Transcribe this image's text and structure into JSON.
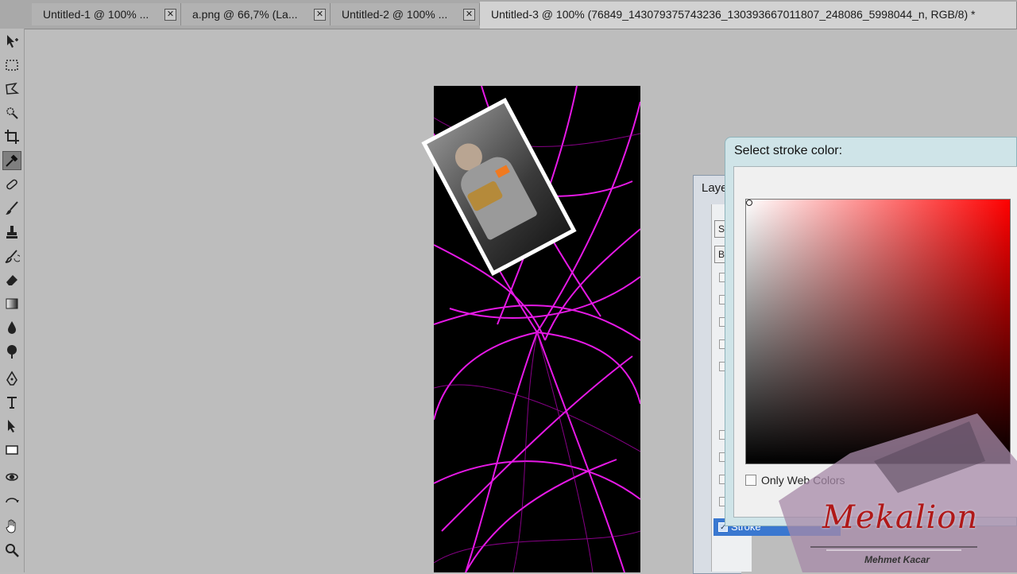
{
  "tabs": [
    {
      "label": "Untitled-1 @ 100% ...",
      "active": false
    },
    {
      "label": "a.png @ 66,7% (La...",
      "active": false
    },
    {
      "label": "Untitled-2 @ 100% ...",
      "active": false
    },
    {
      "label": "Untitled-3 @ 100% (76849_143079375743236_130393667011807_248086_5998044_n, RGB/8) *",
      "active": true
    }
  ],
  "tools": [
    "move-icon",
    "marquee-icon",
    "lasso-icon",
    "quick-select-icon",
    "crop-icon",
    "eyedropper-icon",
    "healing-brush-icon",
    "brush-icon",
    "clone-stamp-icon",
    "history-brush-icon",
    "eraser-icon",
    "gradient-icon",
    "blur-icon",
    "dodge-icon",
    "pen-icon",
    "type-icon",
    "path-select-icon",
    "rectangle-icon",
    "3d-rotate-icon",
    "3d-orbit-icon",
    "hand-icon",
    "zoom-icon"
  ],
  "selected_tool": "eyedropper-icon",
  "layer_style_dialog": {
    "title_fragment": "Laye",
    "tab_fragments": [
      "St",
      "Bl"
    ],
    "selected_row": "Stroke"
  },
  "color_picker": {
    "title": "Select stroke color:",
    "hue": "#ff0000",
    "only_web_colors_label": "Only Web Colors",
    "only_web_colors_checked": false
  },
  "watermark": {
    "title": "Mekalion",
    "subtitle": "Mehmet Kacar"
  },
  "colors": {
    "canvas_bg": "#000000",
    "fractal": "#ff00ff",
    "workspace": "#bdbdbd"
  }
}
